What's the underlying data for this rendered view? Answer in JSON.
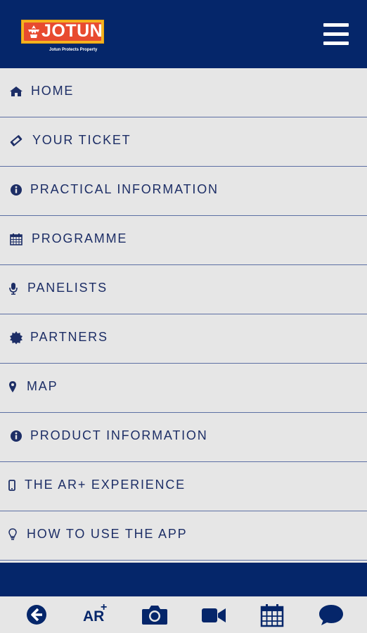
{
  "header": {
    "logo_text": "JOTUN",
    "logo_tagline": "Jotun Protects Property",
    "menu_icon": "hamburger-icon"
  },
  "menu": {
    "items": [
      {
        "label": "HOME",
        "icon": "home-icon"
      },
      {
        "label": "YOUR TICKET",
        "icon": "ticket-icon"
      },
      {
        "label": "PRACTICAL INFORMATION",
        "icon": "info-icon"
      },
      {
        "label": "PROGRAMME",
        "icon": "calendar-icon"
      },
      {
        "label": "PANELISTS",
        "icon": "microphone-icon"
      },
      {
        "label": "PARTNERS",
        "icon": "certificate-icon"
      },
      {
        "label": "MAP",
        "icon": "map-marker-icon"
      },
      {
        "label": "PRODUCT INFORMATION",
        "icon": "info-icon"
      },
      {
        "label": "THE AR+ EXPERIENCE",
        "icon": "mobile-icon"
      },
      {
        "label": "HOW TO USE THE APP",
        "icon": "lightbulb-icon"
      }
    ]
  },
  "toolbar": {
    "items": [
      {
        "icon": "back-arrow-icon"
      },
      {
        "label": "AR",
        "superscript": "+",
        "icon": "ar-plus-icon"
      },
      {
        "icon": "camera-icon"
      },
      {
        "icon": "video-camera-icon"
      },
      {
        "icon": "calendar-icon"
      },
      {
        "icon": "chat-icon"
      }
    ]
  },
  "colors": {
    "brand_navy": "#05266a",
    "menu_text": "#1d2e66",
    "menu_bg": "#e6e6e6",
    "logo_yellow": "#f4b321",
    "logo_red": "#e84b2f"
  }
}
